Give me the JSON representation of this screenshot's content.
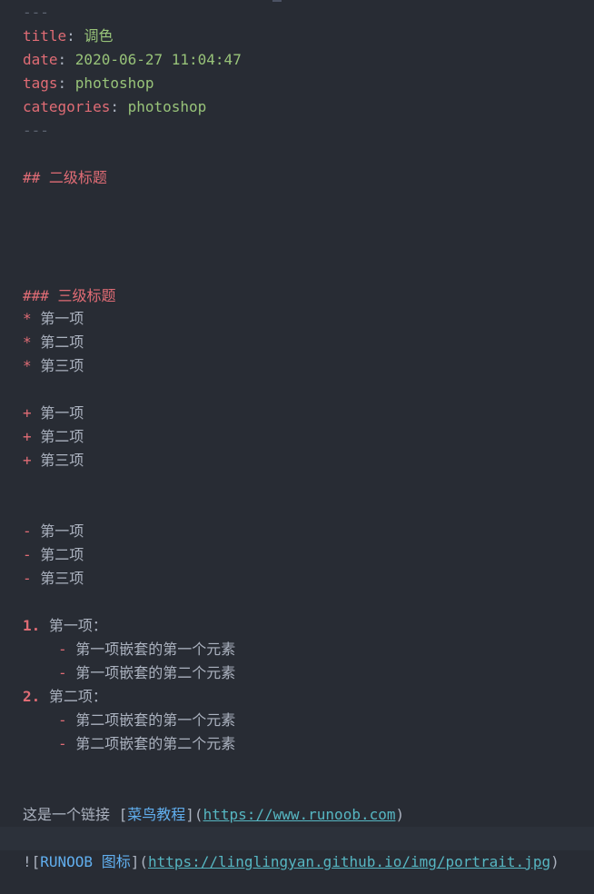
{
  "front_matter": {
    "open_delim": "---",
    "close_delim": "---",
    "title_key": "title",
    "title_value": "调色",
    "date_key": "date",
    "date_value": "2020-06-27 11:04:47",
    "tags_key": "tags",
    "tags_value": "photoshop",
    "categories_key": "categories",
    "categories_value": "photoshop",
    "separator": ": "
  },
  "h2": {
    "marker": "##",
    "text": "二级标题"
  },
  "h3": {
    "marker": "###",
    "text": "三级标题"
  },
  "star_list": {
    "marker": "*",
    "items": [
      "第一项",
      "第二项",
      "第三项"
    ]
  },
  "plus_list": {
    "marker": "+",
    "items": [
      "第一项",
      "第二项",
      "第三项"
    ]
  },
  "dash_list": {
    "marker": "-",
    "items": [
      "第一项",
      "第二项",
      "第三项"
    ]
  },
  "ordered_list": {
    "items": [
      {
        "marker": "1.",
        "text": "第一项：",
        "children": [
          "第一项嵌套的第一个元素",
          "第一项嵌套的第二个元素"
        ]
      },
      {
        "marker": "2.",
        "text": "第二项：",
        "children": [
          "第二项嵌套的第一个元素",
          "第二项嵌套的第二个元素"
        ]
      }
    ],
    "child_marker": "-"
  },
  "link_line": {
    "prefix": "这是一个链接 ",
    "open_bracket": "[",
    "text": "菜鸟教程",
    "close_bracket_paren": "](",
    "url": "https://www.runoob.com",
    "close_paren": ")"
  },
  "image_line": {
    "bang_bracket": "![",
    "alt": "RUNOOB 图标",
    "close_bracket_paren": "](",
    "url": "https://linglingyan.github.io/img/portrait.jpg",
    "close_paren": ")"
  },
  "colors": {
    "background": "#282c34",
    "key": "#e06c75",
    "value": "#98c379",
    "text": "#abb2bf",
    "link": "#61afef",
    "url": "#56b6c2"
  }
}
